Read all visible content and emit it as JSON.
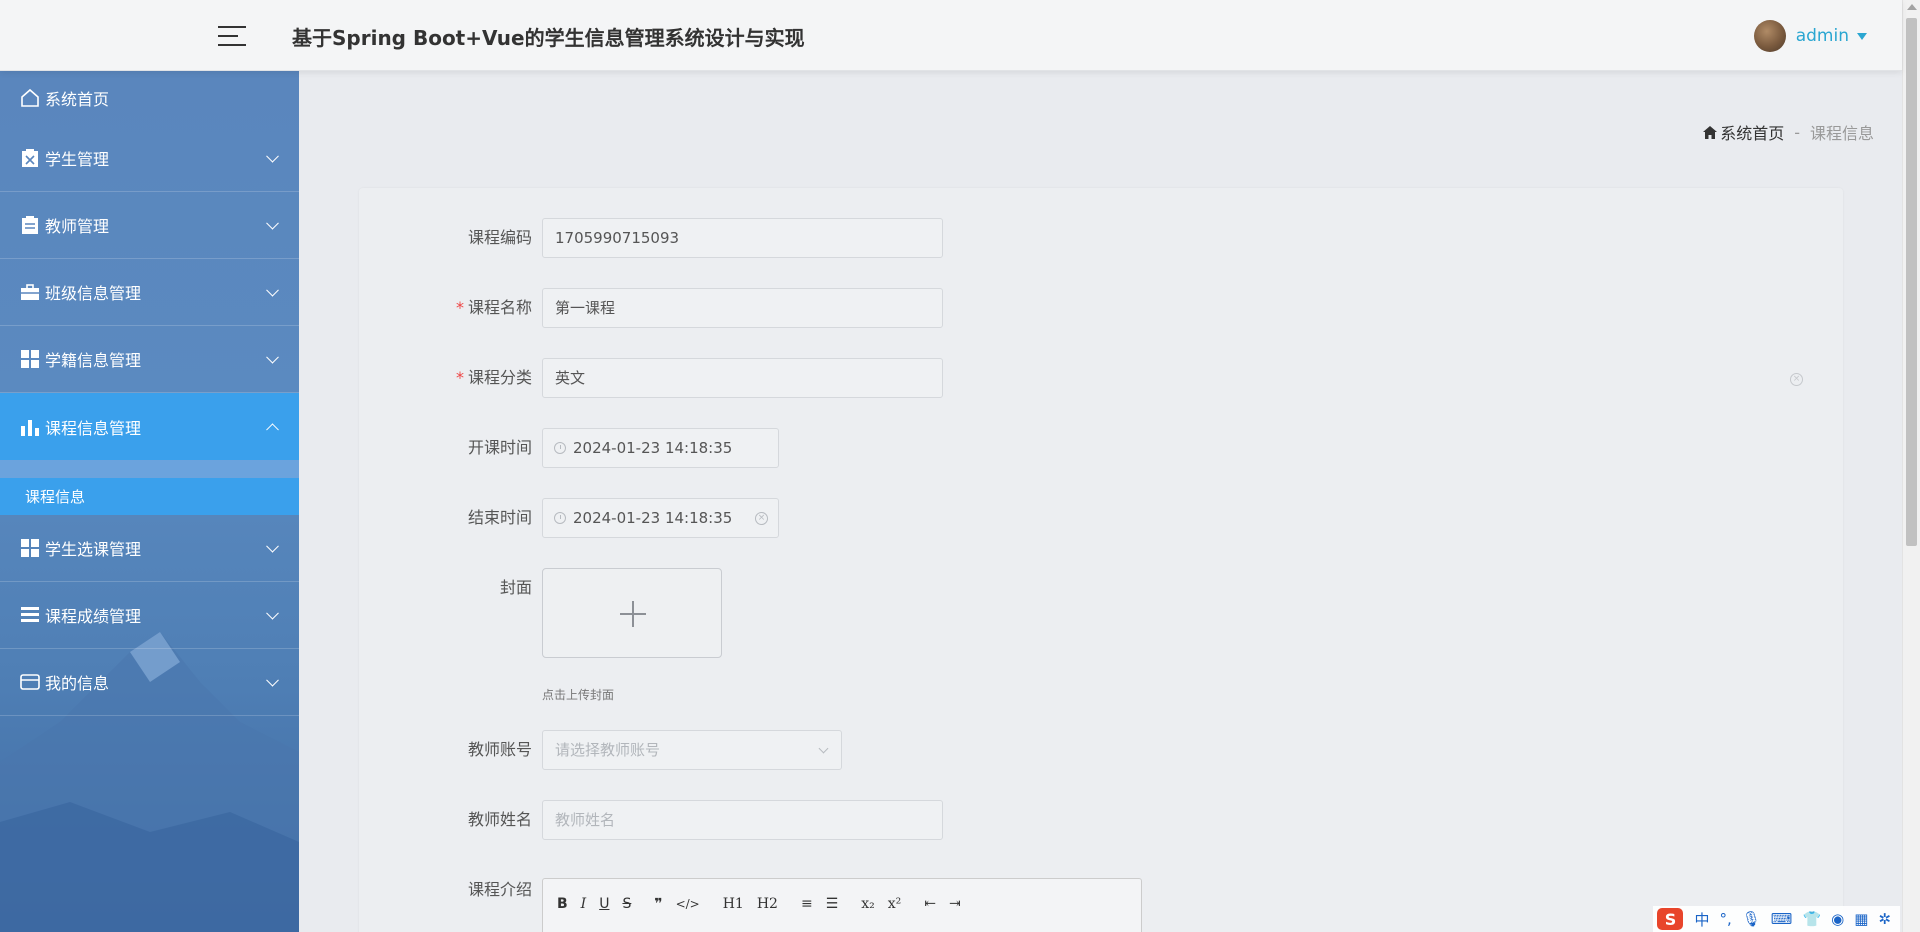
{
  "header": {
    "title": "基于Spring Boot+Vue的学生信息管理系统设计与实现",
    "user": "admin"
  },
  "sidebar": {
    "items": [
      {
        "label": "系统首页",
        "icon": "home-icon"
      },
      {
        "label": "学生管理",
        "icon": "clipboard-x-icon"
      },
      {
        "label": "教师管理",
        "icon": "clipboard-icon"
      },
      {
        "label": "班级信息管理",
        "icon": "briefcase-icon"
      },
      {
        "label": "学籍信息管理",
        "icon": "grid-icon"
      },
      {
        "label": "课程信息管理",
        "icon": "bar-chart-icon"
      },
      {
        "label": "学生选课管理",
        "icon": "grid-icon"
      },
      {
        "label": "课程成绩管理",
        "icon": "list-icon"
      },
      {
        "label": "我的信息",
        "icon": "wallet-icon"
      }
    ],
    "active_sub": "课程信息"
  },
  "breadcrumb": {
    "home": "系统首页",
    "sep": "-",
    "current": "课程信息"
  },
  "form": {
    "code": {
      "label": "课程编码",
      "value": "1705990715093"
    },
    "name": {
      "label": "课程名称",
      "value": "第一课程",
      "required": "*"
    },
    "category": {
      "label": "课程分类",
      "value": "英文",
      "required": "*"
    },
    "start": {
      "label": "开课时间",
      "value": "2024-01-23 14:18:35"
    },
    "end": {
      "label": "结束时间",
      "value": "2024-01-23 14:18:35"
    },
    "cover": {
      "label": "封面",
      "hint": "点击上传封面"
    },
    "teacher_account": {
      "label": "教师账号",
      "placeholder": "请选择教师账号"
    },
    "teacher_name": {
      "label": "教师姓名",
      "placeholder": "教师姓名"
    },
    "intro": {
      "label": "课程介绍"
    }
  },
  "editor_toolbar": [
    "B",
    "I",
    "U",
    "S",
    "❞",
    "</>",
    "H1",
    "H2",
    "≡",
    "☰",
    "x₂",
    "x²",
    "⇤",
    "⇥"
  ],
  "ime": {
    "lang": "中",
    "punct": "°,"
  },
  "colors": {
    "accent": "#3aa0ec",
    "sidebar": "#5a86bd",
    "link": "#2aa6d1"
  }
}
